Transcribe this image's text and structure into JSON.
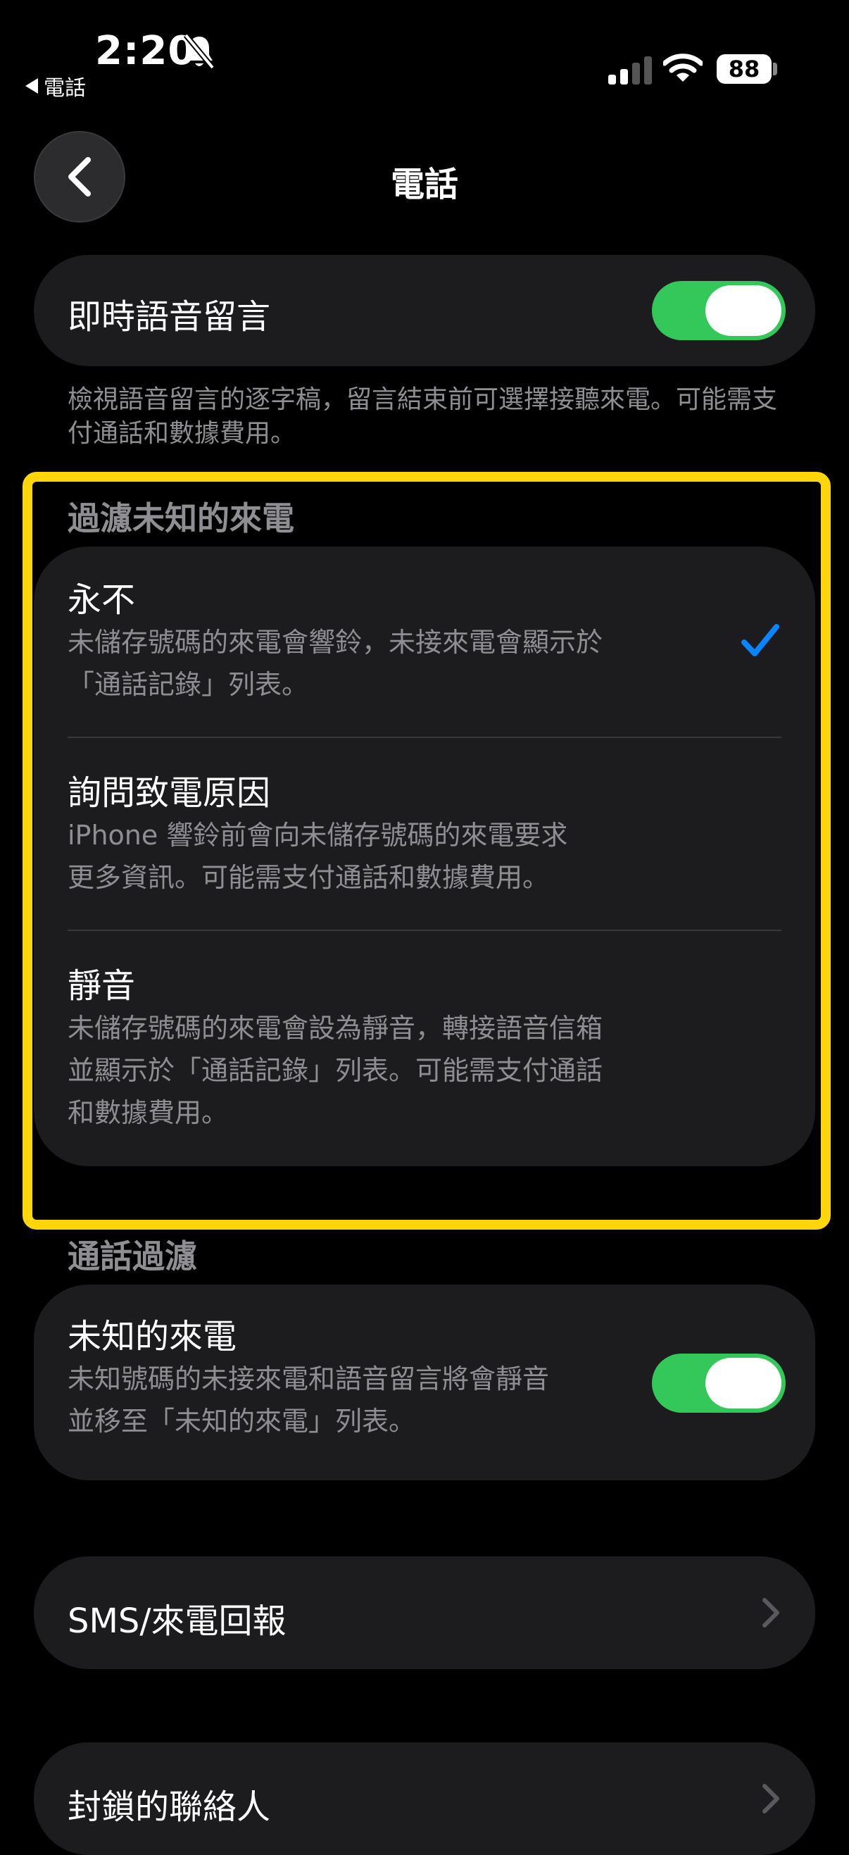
{
  "status_bar": {
    "time": "2:20",
    "back_app": "電話",
    "battery": "88",
    "icons": [
      "bell-slash-icon",
      "signal-icon",
      "wifi-icon",
      "battery-icon"
    ]
  },
  "nav": {
    "title": "電話",
    "back_icon": "chevron-left-icon"
  },
  "live_voicemail": {
    "label": "即時語音留言",
    "toggle_on": true,
    "footer": "檢視語音留言的逐字稿，留言結束前可選擇接聽來電。可能需支付通話和數據費用。"
  },
  "screen_unknown": {
    "header": "過濾未知的來電",
    "options": [
      {
        "title": "永不",
        "desc_lines": [
          "未儲存號碼的來電會響鈴，未接來電會顯示於",
          "「通話記錄」列表。"
        ],
        "selected": true
      },
      {
        "title": "詢問致電原因",
        "desc_lines": [
          "iPhone 響鈴前會向未儲存號碼的來電要求",
          "更多資訊。可能需支付通話和數據費用。"
        ],
        "selected": false
      },
      {
        "title": "靜音",
        "desc_lines": [
          "未儲存號碼的來電會設為靜音，轉接語音信箱",
          "並顯示於「通話記錄」列表。可能需支付通話",
          "和數據費用。"
        ],
        "selected": false
      }
    ]
  },
  "call_filtering": {
    "header": "通話過濾",
    "label": "未知的來電",
    "desc_lines": [
      "未知號碼的未接來電和語音留言將會靜音",
      "並移至「未知的來電」列表。"
    ],
    "toggle_on": true
  },
  "sms_reporting": {
    "label": "SMS/來電回報"
  },
  "blocked_contacts": {
    "label": "封鎖的聯絡人"
  },
  "colors": {
    "accent_toggle": "#34c759",
    "checkmark": "#0a84ff",
    "highlight": "#ffd60a",
    "card_bg": "#1c1c1e",
    "secondary_text": "#8e8e93"
  }
}
